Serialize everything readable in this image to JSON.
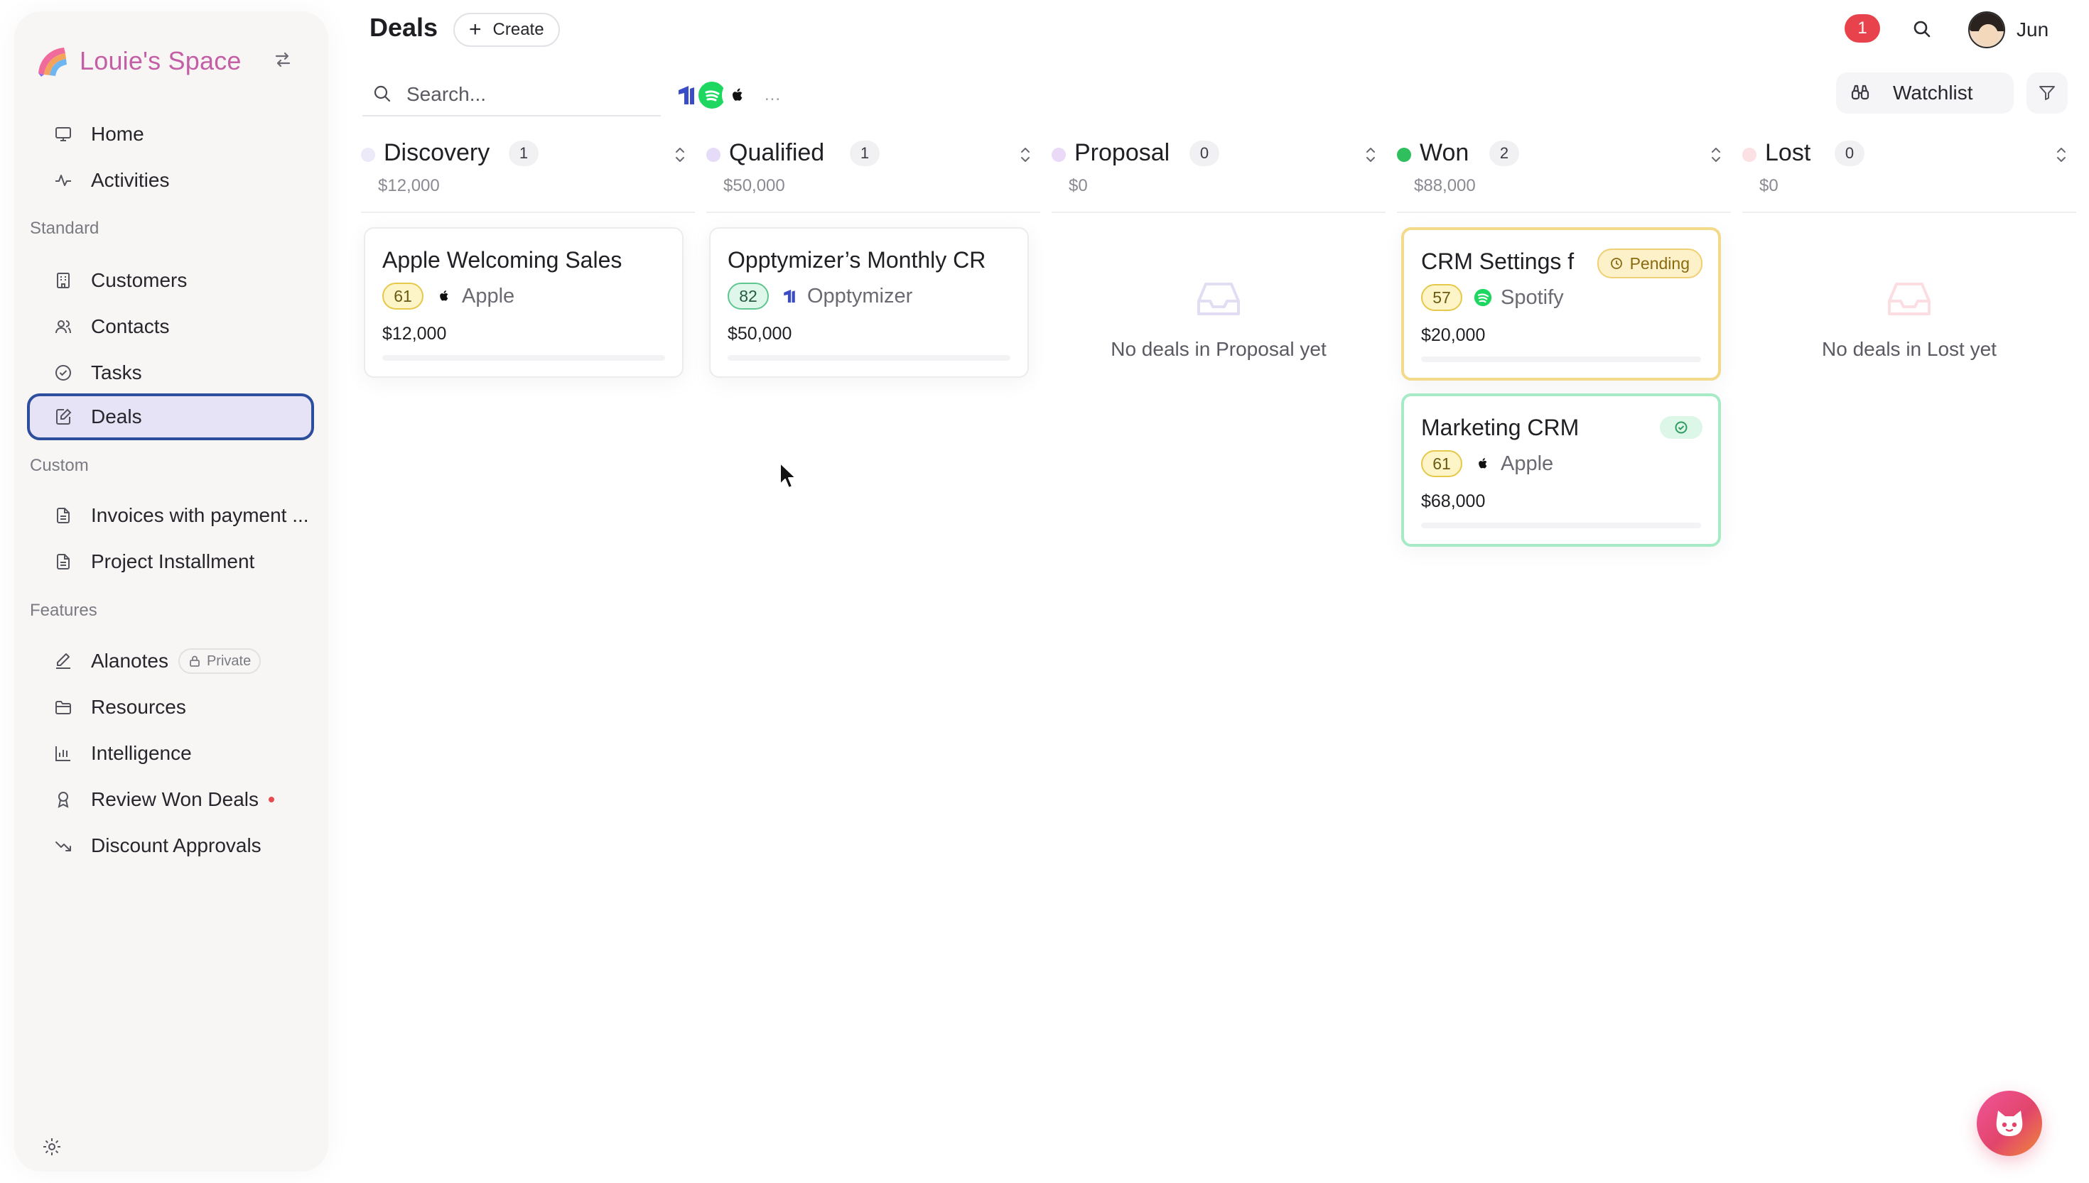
{
  "workspace": {
    "name": "Louie's Space"
  },
  "sidebar": {
    "primary": [
      {
        "label": "Home",
        "icon": "monitor-icon"
      },
      {
        "label": "Activities",
        "icon": "activity-icon"
      }
    ],
    "sections": {
      "standard": "Standard",
      "custom": "Custom",
      "features": "Features"
    },
    "standard": [
      {
        "label": "Customers",
        "icon": "building-icon"
      },
      {
        "label": "Contacts",
        "icon": "users-icon"
      },
      {
        "label": "Tasks",
        "icon": "check-circle-icon"
      },
      {
        "label": "Deals",
        "icon": "edit-icon",
        "active": true
      }
    ],
    "custom": [
      {
        "label": "Invoices with payment ...",
        "icon": "file-icon"
      },
      {
        "label": "Project Installment",
        "icon": "file-icon"
      }
    ],
    "features": [
      {
        "label": "Alanotes",
        "icon": "pen-icon",
        "badge": "Private"
      },
      {
        "label": "Resources",
        "icon": "folder-icon"
      },
      {
        "label": "Intelligence",
        "icon": "bar-chart-icon"
      },
      {
        "label": "Review Won Deals",
        "icon": "award-icon",
        "dot": true
      },
      {
        "label": "Discount Approvals",
        "icon": "trend-down-icon"
      }
    ]
  },
  "header": {
    "title": "Deals",
    "create_label": "Create",
    "notification_count": "1",
    "user_name": "Jun"
  },
  "toolbar": {
    "search_placeholder": "Search...",
    "more": "...",
    "watchlist_label": "Watchlist"
  },
  "colors": {
    "discovery": "#ece9f8",
    "qualified": "#e6dcf7",
    "proposal": "#ead9f7",
    "won": "#2fbf5c",
    "lost": "#fbe0e4",
    "accent": "#2d4e9c"
  },
  "columns": [
    {
      "name": "Discovery",
      "count": "1",
      "total": "$12,000"
    },
    {
      "name": "Qualified",
      "count": "1",
      "total": "$50,000"
    },
    {
      "name": "Proposal",
      "count": "0",
      "total": "$0",
      "empty": "No deals in Proposal yet"
    },
    {
      "name": "Won",
      "count": "2",
      "total": "$88,000"
    },
    {
      "name": "Lost",
      "count": "0",
      "total": "$0",
      "empty": "No deals in Lost yet"
    }
  ],
  "cards": [
    {
      "title": "Apple Welcoming Sales",
      "score": "61",
      "company": "Apple",
      "amount": "$12,000"
    },
    {
      "title": "Opptymizer’s Monthly CR",
      "score": "82",
      "company": "Opptymizer",
      "amount": "$50,000"
    },
    {
      "title": "CRM Settings f",
      "score": "57",
      "company": "Spotify",
      "amount": "$20,000",
      "badge": "Pending"
    },
    {
      "title": "Marketing CRM",
      "score": "61",
      "company": "Apple",
      "amount": "$68,000"
    }
  ]
}
